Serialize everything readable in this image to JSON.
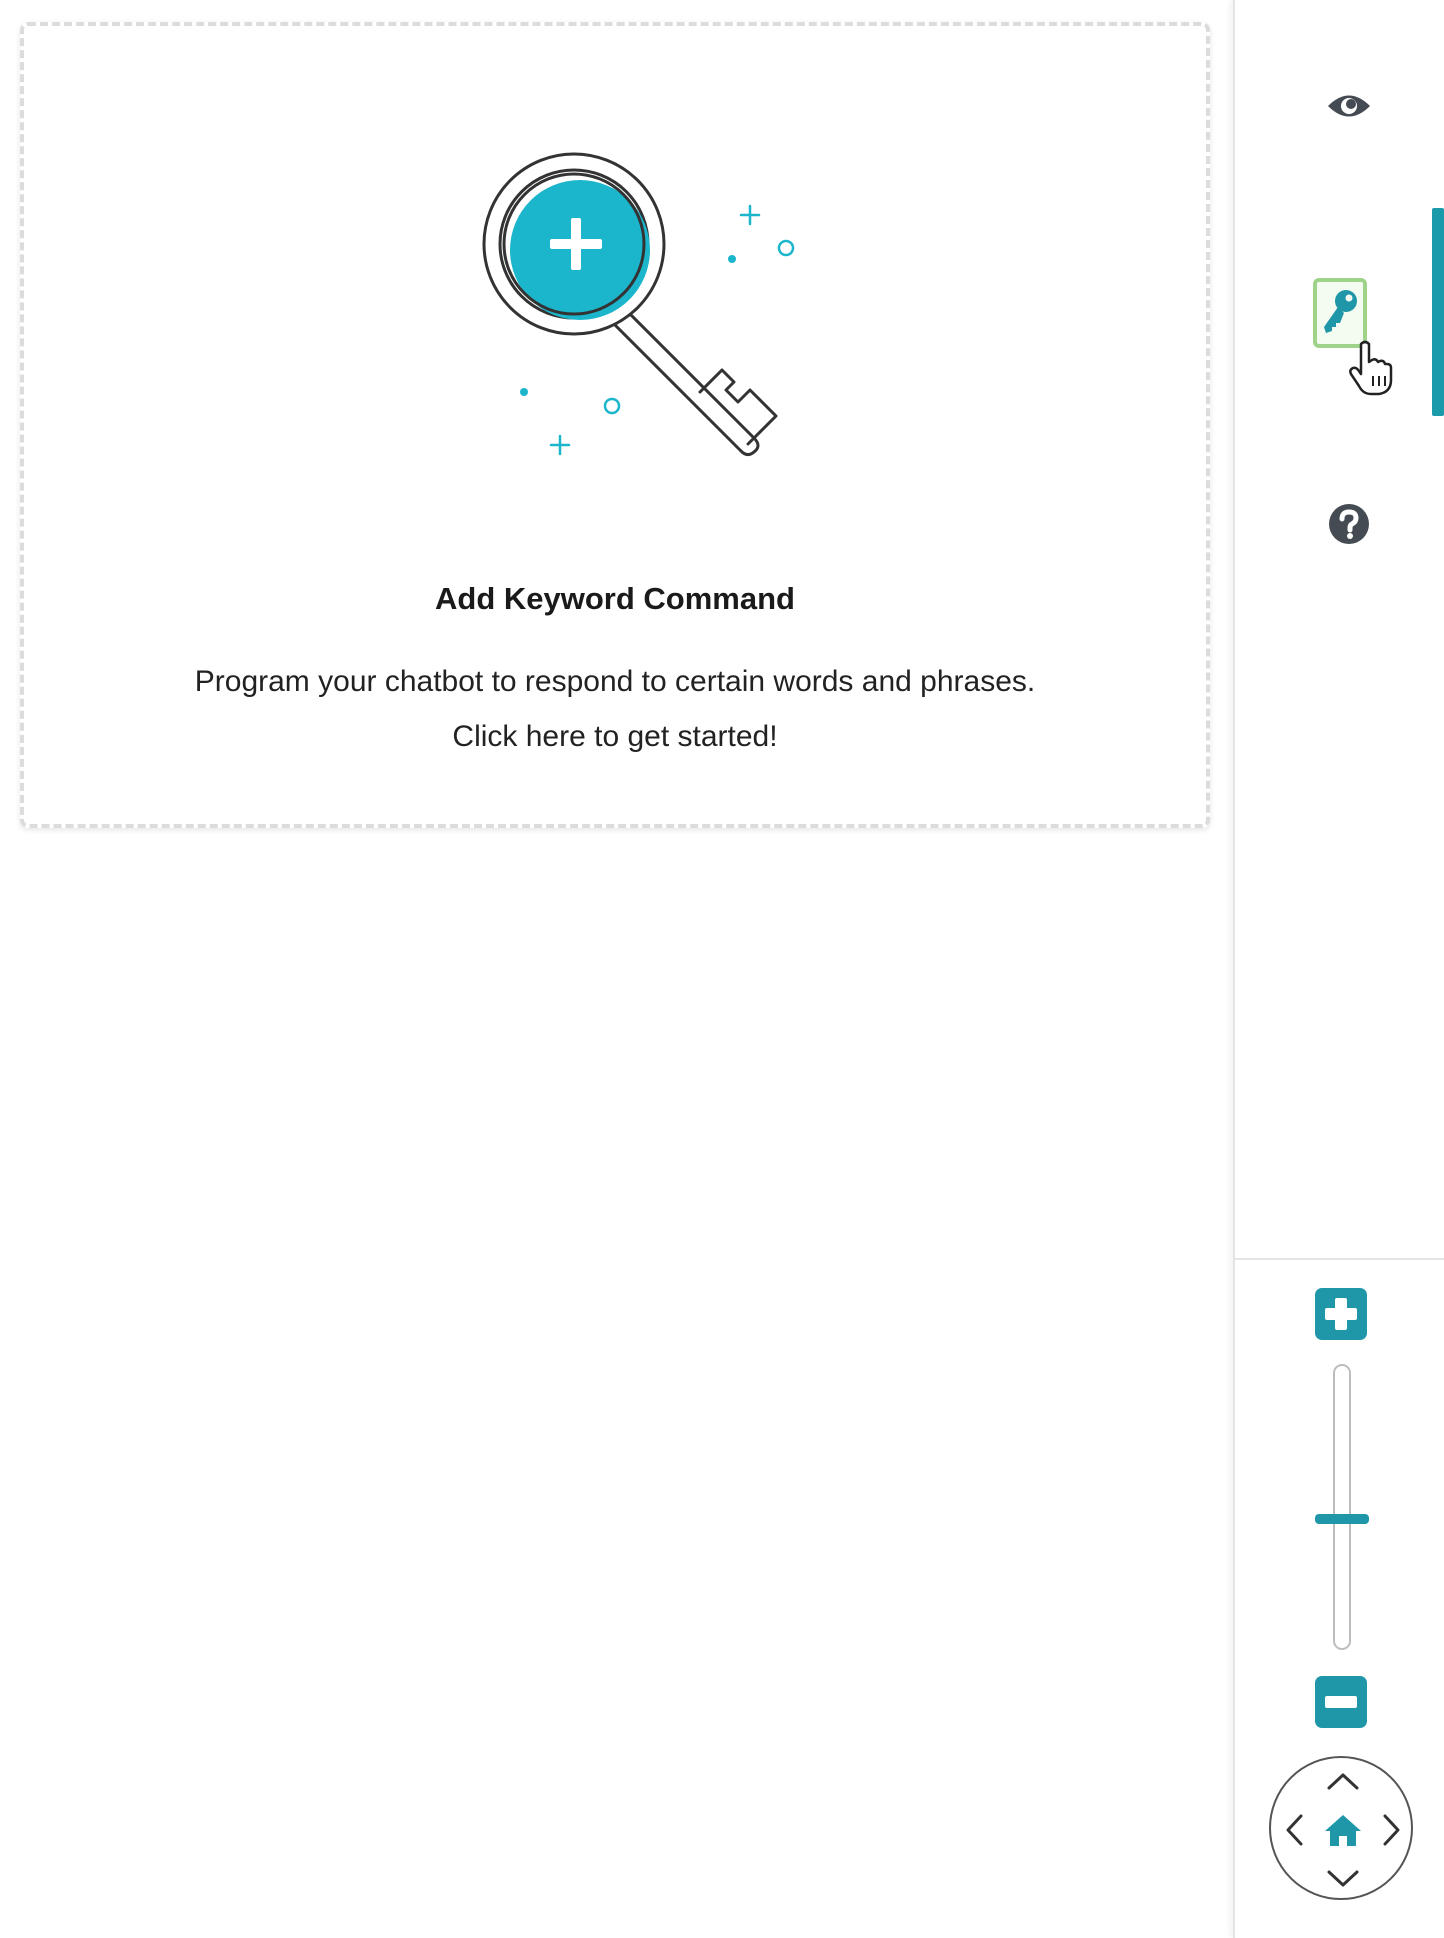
{
  "keyword_card": {
    "title": "Add Keyword Command",
    "description": "Program your chatbot to respond to certain words and phrases. Click here to get started!",
    "illustration_icon": "magnifier-key-plus-icon"
  },
  "toolbar": {
    "items": [
      {
        "icon": "eye-icon",
        "active": false
      },
      {
        "icon": "key-icon",
        "active": true
      },
      {
        "icon": "help-icon",
        "active": false
      }
    ]
  },
  "zoom": {
    "level": 0.45,
    "zoom_in_icon": "plus-icon",
    "zoom_out_icon": "minus-icon"
  },
  "navigation": {
    "icons": [
      "chevron-up-icon",
      "chevron-down-icon",
      "chevron-left-icon",
      "chevron-right-icon",
      "home-icon"
    ]
  },
  "colors": {
    "accent": "#1f97a8",
    "illustration_teal": "#1cb6cc",
    "highlight_green": "#9ed38a",
    "icon_dark": "#444b52"
  }
}
